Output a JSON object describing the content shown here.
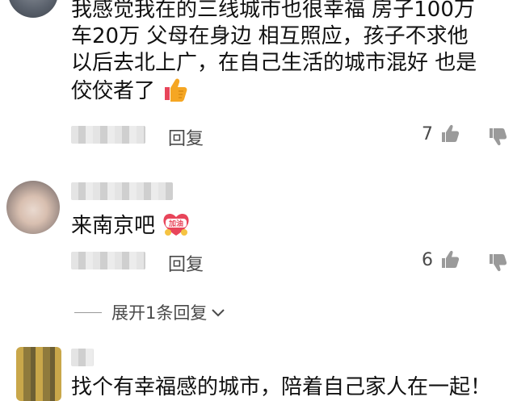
{
  "comments": [
    {
      "lines": [
        "我感觉我在的三线城市也很幸福 房子100万",
        "车20万 父母在身边 相互照应，孩子不求他",
        "以后去北上广，在自己生活的城市混好 也是",
        "佼佼者了"
      ],
      "emoji": "thumbs-up",
      "reply_label": "回复",
      "likes": "7"
    },
    {
      "text": "来南京吧",
      "emoji_label": "加油",
      "reply_label": "回复",
      "likes": "6",
      "expand_label": "展开1条回复"
    },
    {
      "text": "找个有幸福感的城市，陪着自己家人在一起！"
    }
  ],
  "colors": {
    "text": "#111111",
    "meta": "#4a4a4a",
    "emoji_orange": "#f5a623",
    "emoji_red": "#e8455a"
  }
}
